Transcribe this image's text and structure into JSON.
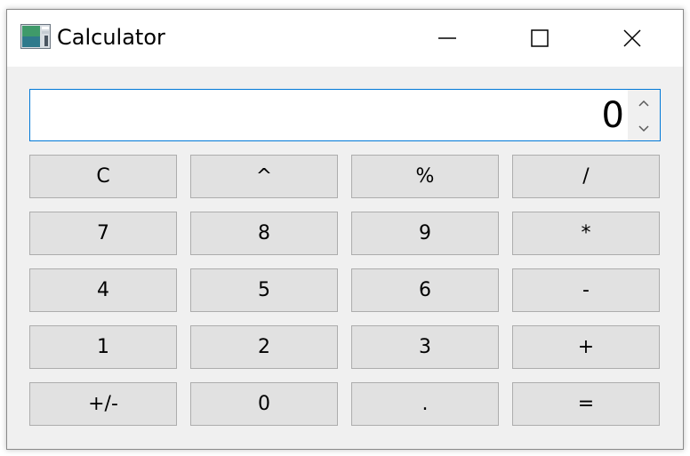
{
  "window": {
    "title": "Calculator",
    "icon": "calculator-app-icon",
    "controls": {
      "minimize": "minimize-icon",
      "maximize": "maximize-icon",
      "close": "close-icon"
    }
  },
  "display": {
    "value": "0",
    "spin_up": "chevron-up-icon",
    "spin_down": "chevron-down-icon",
    "border_color": "#0078d7"
  },
  "keys": [
    {
      "label": "C",
      "name": "clear-button"
    },
    {
      "label": "^",
      "name": "power-button"
    },
    {
      "label": "%",
      "name": "percent-button"
    },
    {
      "label": "/",
      "name": "divide-button"
    },
    {
      "label": "7",
      "name": "digit-7-button"
    },
    {
      "label": "8",
      "name": "digit-8-button"
    },
    {
      "label": "9",
      "name": "digit-9-button"
    },
    {
      "label": "*",
      "name": "multiply-button"
    },
    {
      "label": "4",
      "name": "digit-4-button"
    },
    {
      "label": "5",
      "name": "digit-5-button"
    },
    {
      "label": "6",
      "name": "digit-6-button"
    },
    {
      "label": "-",
      "name": "subtract-button"
    },
    {
      "label": "1",
      "name": "digit-1-button"
    },
    {
      "label": "2",
      "name": "digit-2-button"
    },
    {
      "label": "3",
      "name": "digit-3-button"
    },
    {
      "label": "+",
      "name": "add-button"
    },
    {
      "label": "+/-",
      "name": "negate-button"
    },
    {
      "label": "0",
      "name": "digit-0-button"
    },
    {
      "label": ".",
      "name": "decimal-point-button"
    },
    {
      "label": "=",
      "name": "equals-button"
    }
  ],
  "colors": {
    "window_bg": "#f0f0f0",
    "key_bg": "#e1e1e1",
    "key_border": "#adadad"
  }
}
